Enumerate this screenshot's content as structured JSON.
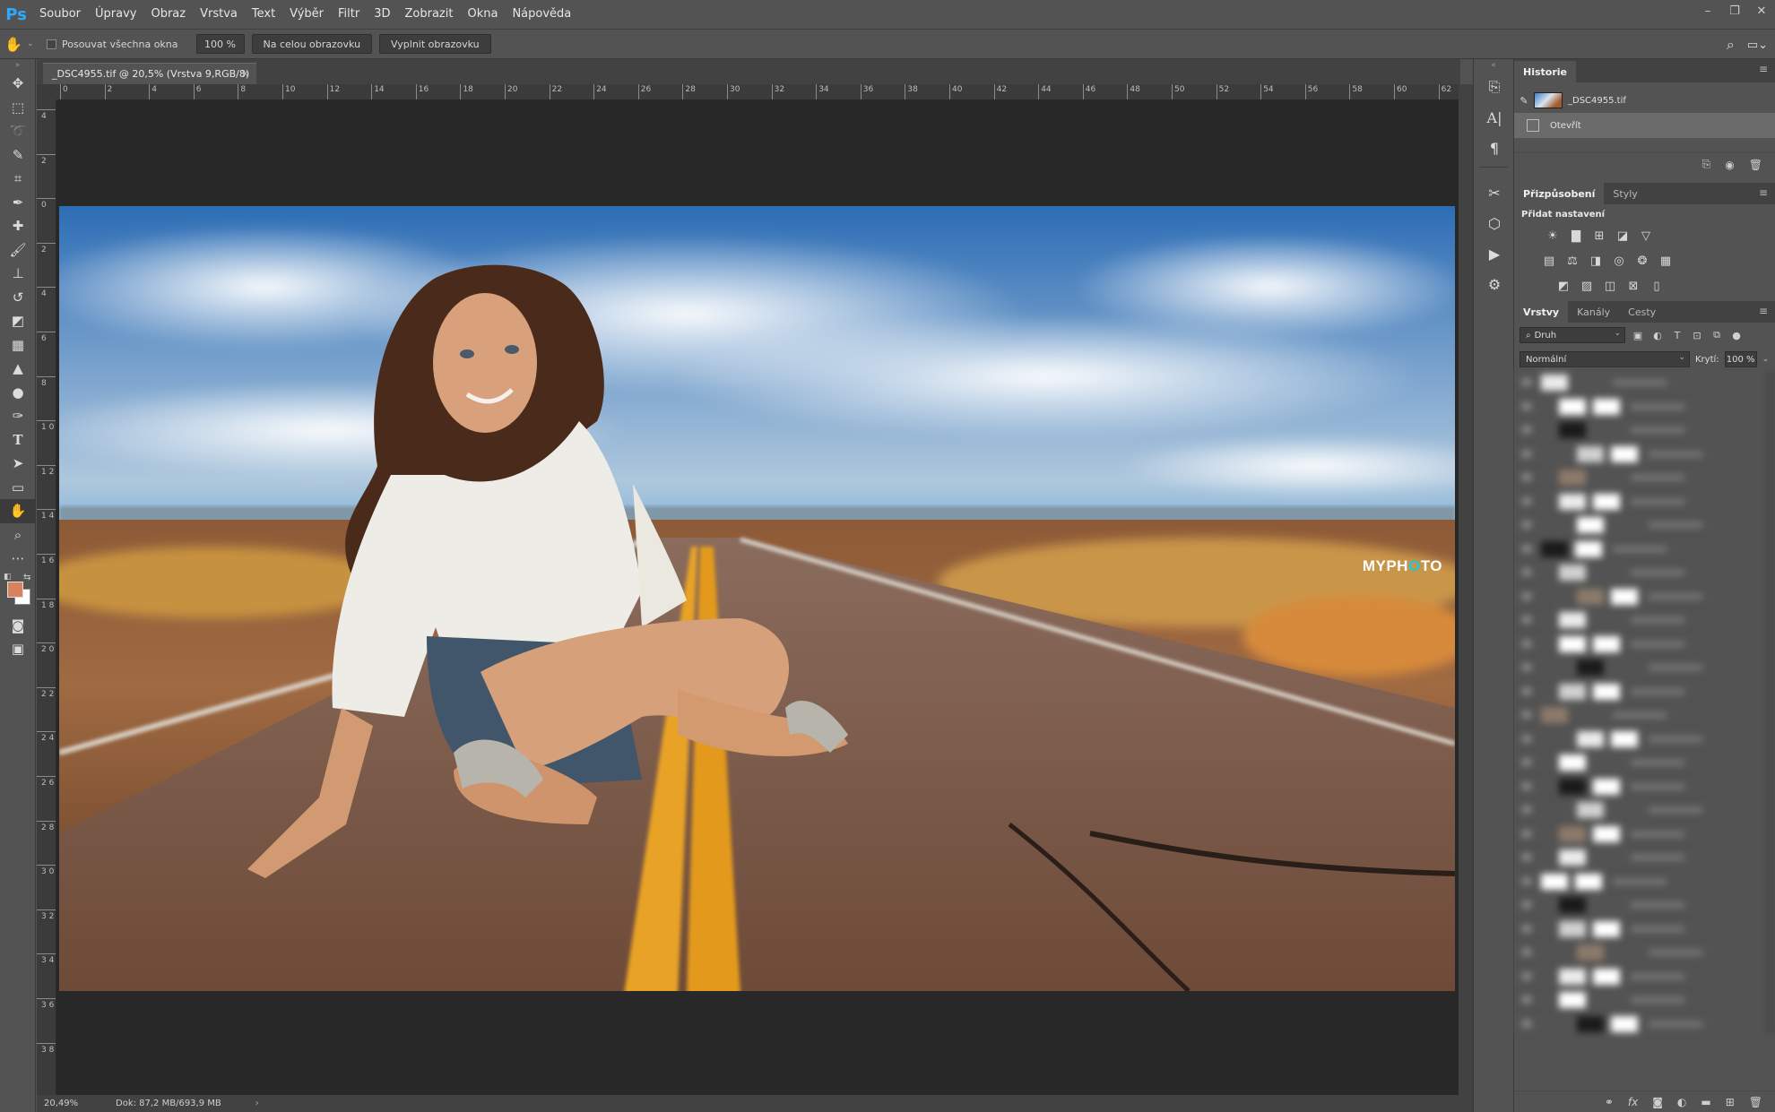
{
  "app": {
    "logo": "Ps"
  },
  "menu": [
    "Soubor",
    "Úpravy",
    "Obraz",
    "Vrstva",
    "Text",
    "Výběr",
    "Filtr",
    "3D",
    "Zobrazit",
    "Okna",
    "Nápověda"
  ],
  "window_controls": {
    "minimize": "–",
    "restore": "❐",
    "close": "✕"
  },
  "options": {
    "scroll_all_label": "Posouvat všechna okna",
    "zoom_value": "100 %",
    "fit_screen_label": "Na celou obrazovku",
    "fill_screen_label": "Vyplnit obrazovku"
  },
  "document": {
    "tab_title": "_DSC4955.tif @ 20,5% (Vrstva 9,RGB/8)",
    "watermark_main": "MYPH",
    "watermark_accent": "O",
    "watermark_end": "TO"
  },
  "ruler": {
    "top": [
      "0",
      "2",
      "4",
      "6",
      "8",
      "10",
      "12",
      "14",
      "16",
      "18",
      "20",
      "22",
      "24",
      "26",
      "28",
      "30",
      "32",
      "34",
      "36",
      "38",
      "40",
      "42",
      "44",
      "46",
      "48",
      "50",
      "52",
      "54",
      "56",
      "58",
      "60",
      "62"
    ],
    "left": [
      "4",
      "2",
      "0",
      "2",
      "4",
      "6",
      "8",
      "1 0",
      "1 2",
      "1 4",
      "1 6",
      "1 8",
      "2 0",
      "2 2",
      "2 4",
      "2 6",
      "2 8",
      "3 0",
      "3 2",
      "3 4",
      "3 6",
      "3 8"
    ]
  },
  "status": {
    "zoom": "20,49%",
    "doc_info": "Dok: 87,2 MB/693,9 MB",
    "arrow": "›"
  },
  "history_panel": {
    "tab": "Historie",
    "snapshot_name": "_DSC4955.tif",
    "step_name": "Otevřít"
  },
  "adjustments_panel": {
    "tab_adjust": "Přizpůsobení",
    "tab_styles": "Styly",
    "add_label": "Přidat nastavení"
  },
  "layers_panel": {
    "tab_layers": "Vrstvy",
    "tab_channels": "Kanály",
    "tab_paths": "Cesty",
    "kind_label": "Druh",
    "blend_mode": "Normální",
    "opacity_label": "Krytí:",
    "opacity_value": "100 %"
  },
  "colors": {
    "foreground": "#d9825f",
    "background": "#ffffff",
    "accent": "#31a8ff"
  },
  "icons": {
    "hand_tool": "hand-icon",
    "search": "search-icon",
    "workspace": "workspace-icon"
  }
}
